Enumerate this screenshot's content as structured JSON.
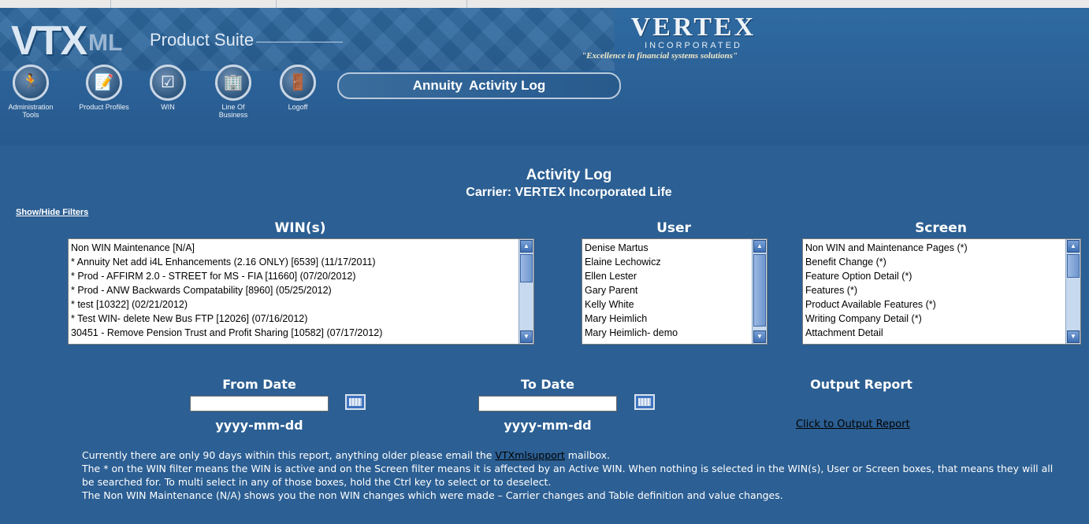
{
  "brand": {
    "logo_main": "VTX",
    "logo_ml": "ML",
    "product_suite": "Product Suite",
    "company": "VERTEX",
    "company_inc": "INCORPORATED",
    "tagline": "\"Excellence in financial systems solutions\""
  },
  "nav": [
    {
      "label": "Administration Tools",
      "icon": "runner-icon"
    },
    {
      "label": "Product Profiles",
      "icon": "document-pencil-icon"
    },
    {
      "label": "WIN",
      "icon": "checkmark-icon"
    },
    {
      "label": "Line Of Business",
      "icon": "building-icon"
    },
    {
      "label": "Logoff",
      "icon": "door-icon"
    }
  ],
  "page_pill": {
    "part1": "Annuity",
    "part2": "Activity Log"
  },
  "page_title": "Activity Log",
  "carrier_line": "Carrier: VERTEX Incorporated Life",
  "show_hide_filters": "Show/Hide Filters",
  "filters": {
    "win_header": "WIN(s)",
    "win_items": [
      "Non WIN Maintenance [N/A]",
      "* Annuity Net add i4L Enhancements (2.16 ONLY) [6539] (11/17/2011)",
      "* Prod - AFFIRM 2.0 - STREET for MS - FIA [11660] (07/20/2012)",
      "* Prod - ANW Backwards Compatability [8960] (05/25/2012)",
      "* test [10322] (02/21/2012)",
      "* Test WIN- delete New Bus FTP [12026] (07/16/2012)",
      "30451 - Remove Pension Trust and Profit Sharing [10582] (07/17/2012)"
    ],
    "user_header": "User",
    "user_items": [
      "Denise Martus",
      "Elaine Lechowicz",
      "Ellen Lester",
      "Gary Parent",
      "Kelly White",
      "Mary Heimlich",
      "Mary Heimlich- demo"
    ],
    "screen_header": "Screen",
    "screen_items": [
      "Non WIN and Maintenance Pages (*)",
      "Benefit Change (*)",
      "Feature Option Detail (*)",
      "Features (*)",
      "Product Available Features (*)",
      "Writing Company Detail (*)",
      "Attachment Detail"
    ]
  },
  "dates": {
    "from_label": "From Date",
    "from_value": "",
    "from_format": "yyyy-mm-dd",
    "to_label": "To Date",
    "to_value": "",
    "to_format": "yyyy-mm-dd"
  },
  "output": {
    "label": "Output Report",
    "link": "Click to Output Report"
  },
  "notes": {
    "line1_pre": "Currently there are only 90 days within this report, anything older please email the ",
    "line1_link": "VTXmlsupport",
    "line1_post": " mailbox.",
    "line2": "The * on the WIN filter means the WIN is active and on the Screen filter means it is affected by an Active WIN. When nothing is selected in the WIN(s), User or Screen boxes, that means they will all be searched for. To multi select in any of those boxes, hold the Ctrl key to select or to deselect.",
    "line3": "The Non WIN Maintenance (N/A) shows you the non WIN changes which were made – Carrier changes and Table definition and value changes."
  },
  "colors": {
    "background": "#2c5f93",
    "scrollbar_arrow": "#3e6fb5"
  }
}
